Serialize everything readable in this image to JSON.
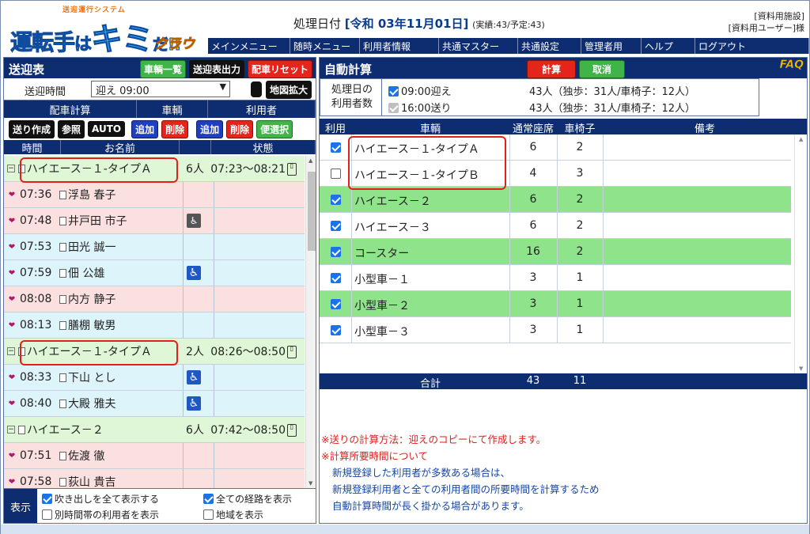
{
  "header": {
    "logo_sub": "送迎運行システム",
    "logo_a": "運転手",
    "logo_b": "は",
    "logo_c": "キミ",
    "logo_d": "だ!!",
    "logo_cloud": "クラウド",
    "proc_label": "処理日付",
    "proc_date": "[令和 03年11月01日]",
    "proc_counts": "(実績:43/予定:43)",
    "facility": "[資料用施設]",
    "user": "[資料用ユーザー]様"
  },
  "menu": [
    "メインメニュー",
    "随時メニュー",
    "利用者情報",
    "共通マスター",
    "共通設定",
    "管理者用",
    "ヘルプ",
    "ログアウト"
  ],
  "left": {
    "title": "送迎表",
    "btn_vehicle_list": "車輌一覧",
    "btn_output": "送迎表出力",
    "btn_reset": "配車リセット",
    "time_label": "送迎時間",
    "time_value": "迎え 09:00",
    "map_btn": "地図拡大",
    "group_calc": "配車計算",
    "group_vehicle": "車輌",
    "group_user": "利用者",
    "btn_create": "送り作成",
    "btn_ref": "参照",
    "btn_auto": "AUTO",
    "btn_v_add": "追加",
    "btn_v_del": "削除",
    "btn_u_add": "追加",
    "btn_u_del": "削除",
    "btn_convenient": "便選択",
    "col_time": "時間",
    "col_name": "お名前",
    "col_status": "状態",
    "rows": [
      {
        "type": "vehicle",
        "name": "ハイエース－１-タイプＡ",
        "cap": "6人",
        "status": "07:23〜08:21"
      },
      {
        "type": "pink",
        "time": "07:36",
        "name": "浮島 春子"
      },
      {
        "type": "pink",
        "time": "07:48",
        "name": "井戸田 市子",
        "icon": "walker"
      },
      {
        "type": "blue",
        "time": "07:53",
        "name": "田光 誠一"
      },
      {
        "type": "blue",
        "time": "07:59",
        "name": "佃 公雄",
        "icon": "wheelchair"
      },
      {
        "type": "pink",
        "time": "08:08",
        "name": "内方 静子"
      },
      {
        "type": "blue",
        "time": "08:13",
        "name": "膳棚 敏男"
      },
      {
        "type": "vehicle",
        "name": "ハイエース－１-タイプＡ",
        "cap": "2人",
        "status": "08:26〜08:50"
      },
      {
        "type": "blue",
        "time": "08:33",
        "name": "下山 とし",
        "icon": "wheelchair"
      },
      {
        "type": "blue",
        "time": "08:40",
        "name": "大殿 雅夫",
        "icon": "wheelchair"
      },
      {
        "type": "vehicle",
        "name": "ハイエース－２",
        "cap": "6人",
        "status": "07:42〜08:50"
      },
      {
        "type": "pink",
        "time": "07:51",
        "name": "佐渡 徹"
      },
      {
        "type": "pink",
        "time": "07:58",
        "name": "荻山 貴吉"
      }
    ],
    "display_label": "表示",
    "opt_balloon": "吹き出しを全て表示する",
    "opt_routes": "全ての経路を表示",
    "opt_other_time": "別時間帯の利用者を表示",
    "opt_area": "地域を表示"
  },
  "right": {
    "title": "自動計算",
    "btn_calc": "計算",
    "btn_cancel": "取消",
    "faq": "FAQ",
    "count_label_1": "処理日の",
    "count_label_2": "利用者数",
    "count_rows": [
      {
        "label": "09:00迎え",
        "value": "43人（独歩：31人/車椅子：12人）",
        "checked": true
      },
      {
        "label": "16:00送り",
        "value": "43人（独歩：31人/車椅子：12人）",
        "checked": "disabled"
      }
    ],
    "col_use": "利用",
    "col_vehicle": "車輌",
    "col_seats": "通常座席",
    "col_wheel": "車椅子",
    "col_note": "備考",
    "vehicles": [
      {
        "name": "ハイエース－１-タイプＡ",
        "seats": "6",
        "wheel": "2",
        "checked": true,
        "green": false
      },
      {
        "name": "ハイエース－１-タイプＢ",
        "seats": "4",
        "wheel": "3",
        "checked": false,
        "green": false
      },
      {
        "name": "ハイエース－２",
        "seats": "6",
        "wheel": "2",
        "checked": true,
        "green": true
      },
      {
        "name": "ハイエース－３",
        "seats": "6",
        "wheel": "2",
        "checked": true,
        "green": false
      },
      {
        "name": "コースター",
        "seats": "16",
        "wheel": "2",
        "checked": true,
        "green": true
      },
      {
        "name": "小型車－１",
        "seats": "3",
        "wheel": "1",
        "checked": true,
        "green": false
      },
      {
        "name": "小型車－２",
        "seats": "3",
        "wheel": "1",
        "checked": true,
        "green": true
      },
      {
        "name": "小型車－３",
        "seats": "3",
        "wheel": "1",
        "checked": true,
        "green": false
      }
    ],
    "total_label": "合計",
    "total_seats": "43",
    "total_wheel": "11",
    "note_1": "※送りの計算方法：迎えのコピーにて作成します。",
    "note_2": "※計算所要時間について",
    "note_3": "新規登録した利用者が多数ある場合は、",
    "note_4": "新規登録利用者と全ての利用者間の所要時間を計算するため",
    "note_5": "自動計算時間が長く掛かる場合があります。"
  }
}
